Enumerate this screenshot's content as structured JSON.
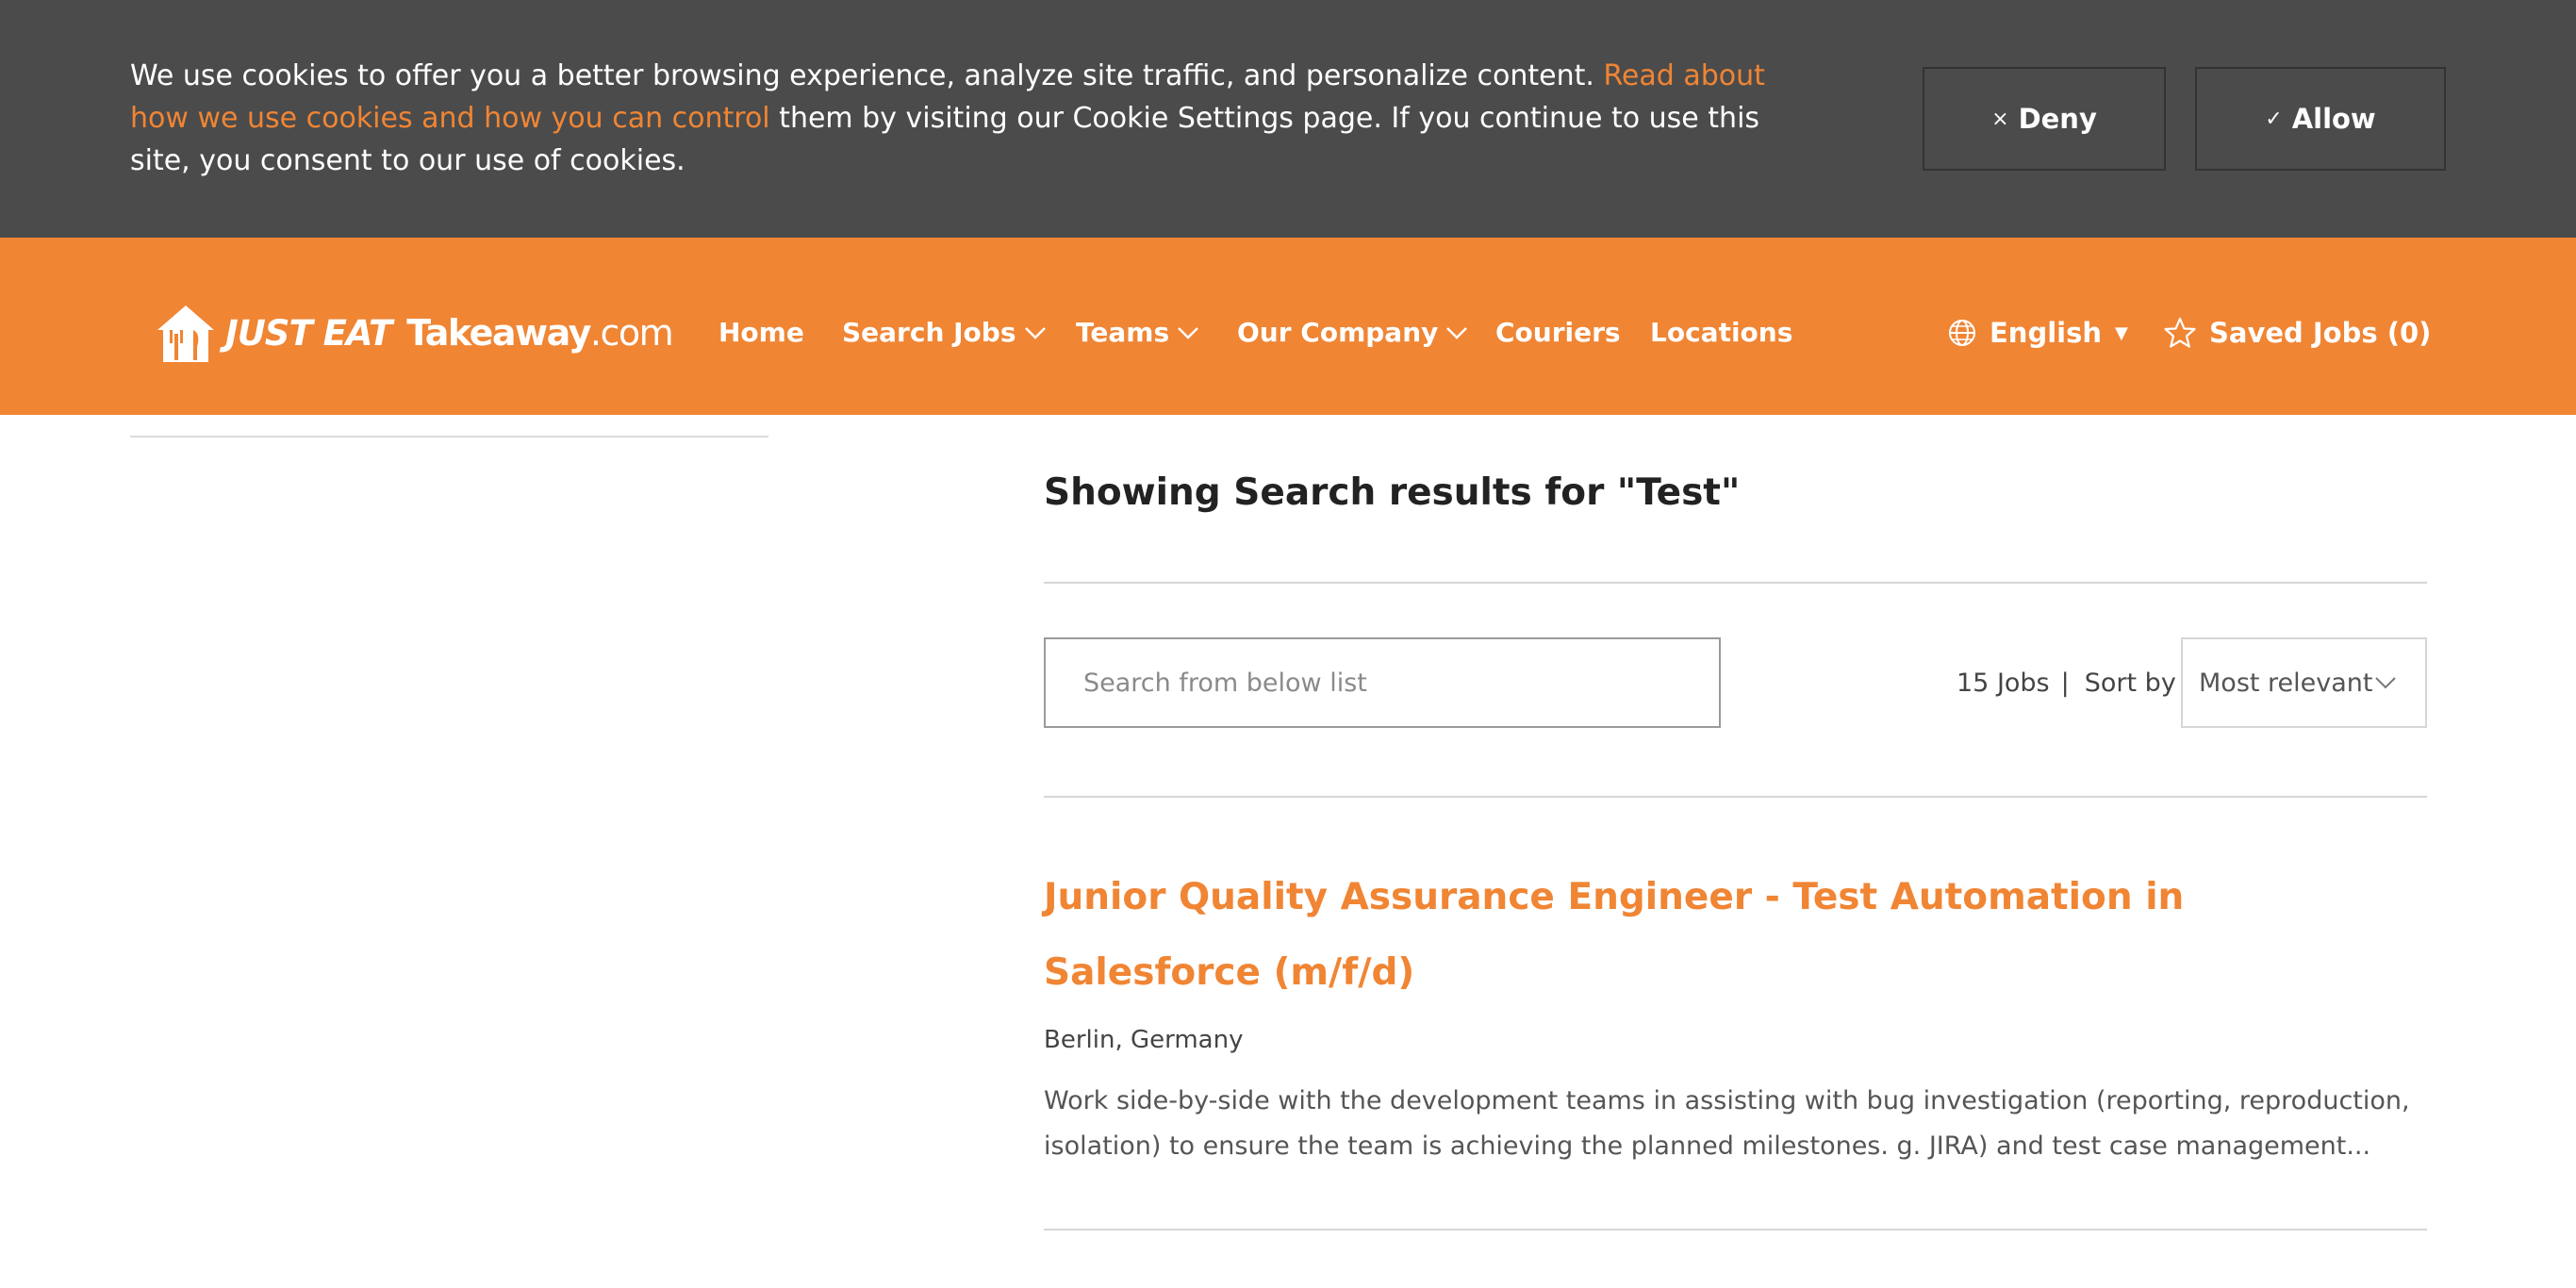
{
  "cookie_banner": {
    "text_before": "We use cookies to offer you a better browsing experience, analyze site traffic, and personalize content. ",
    "link_text": "Read about how we use cookies and how you can control",
    "text_after": " them by visiting our Cookie Settings page. If you continue to use this site, you consent to our use of cookies.",
    "deny_label": "Deny",
    "deny_icon": "×",
    "allow_label": "Allow",
    "allow_icon": "✓"
  },
  "header": {
    "logo": {
      "just_eat": "JUST EAT",
      "takeaway": "Takeaway",
      "dotcom": ".com"
    },
    "nav": {
      "home": "Home",
      "search_jobs": "Search Jobs",
      "teams": "Teams",
      "our_company": "Our Company",
      "couriers": "Couriers",
      "locations": "Locations"
    },
    "language": "English",
    "language_caret": "▼",
    "saved_jobs": "Saved Jobs (0)"
  },
  "results": {
    "heading": "Showing Search results for \"Test\"",
    "search_placeholder": "Search from below list",
    "job_count": "15 Jobs",
    "separator": "|",
    "sort_by_label": "Sort by",
    "sort_selected": "Most relevant"
  },
  "jobs": [
    {
      "title": "Junior Quality Assurance Engineer - Test Automation in Salesforce (m/f/d)",
      "location": "Berlin, Germany",
      "description": "Work side-by-side with the development teams in assisting with bug investigation (reporting, reproduction, isolation) to ensure the team is achieving the planned milestones. g. JIRA) and test case management..."
    }
  ],
  "colors": {
    "brand_orange": "#f08534",
    "banner_gray": "#4b4b4b",
    "text_dark": "#222222"
  },
  "icons": {
    "logo": "house-fork-knife-icon",
    "chevron": "chevron-down-icon",
    "language": "globe-icon",
    "saved": "star-outline-icon"
  }
}
